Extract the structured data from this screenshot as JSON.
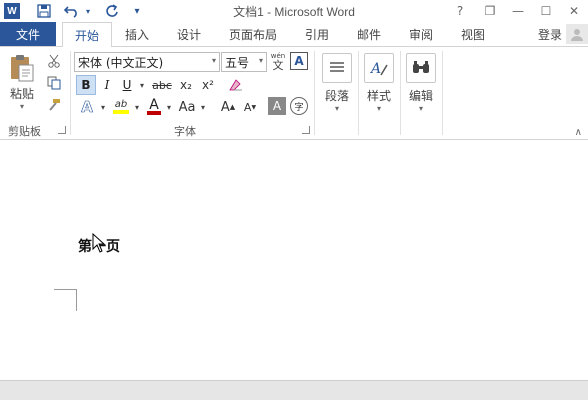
{
  "titlebar": {
    "title": "文档1 - Microsoft Word",
    "logo": "W",
    "qat": {
      "save_icon": "save-icon",
      "undo_icon": "undo-icon",
      "redo_icon": "redo-icon",
      "customize_icon": "chevron-down-icon"
    },
    "controls": {
      "help": "?",
      "restore_ribbon": "❐",
      "minimize": "—",
      "maximize": "☐",
      "close": "✕"
    }
  },
  "tabs": {
    "file": "文件",
    "items": [
      "开始",
      "插入",
      "设计",
      "页面布局",
      "引用",
      "邮件",
      "审阅",
      "视图"
    ],
    "active": "开始",
    "login": "登录"
  },
  "ribbon": {
    "clipboard": {
      "label": "剪贴板",
      "paste": "粘贴"
    },
    "font": {
      "label": "字体",
      "font_name": "宋体 (中文正文)",
      "font_size": "五号",
      "bold": "B",
      "italic": "I",
      "underline": "U",
      "strike": "abc",
      "subscript": "x₂",
      "superscript": "x²",
      "change_case": "Aa",
      "grow": "A",
      "shrink": "A",
      "char_shading": "A",
      "char_border": "A",
      "enclose": "字"
    },
    "paragraph": {
      "label": "段落"
    },
    "styles": {
      "label": "样式"
    },
    "editing": {
      "label": "编辑"
    }
  },
  "document": {
    "text": "第一页"
  },
  "colors": {
    "accent": "#2b579a",
    "highlight": "#ffff00",
    "font_color": "#c00000"
  }
}
